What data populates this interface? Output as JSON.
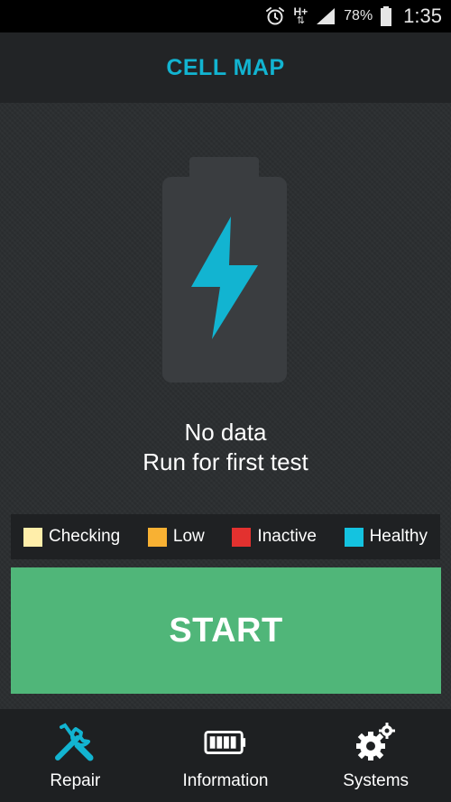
{
  "status_bar": {
    "network_label": "H+",
    "battery_percent": "78%",
    "time": "1:35",
    "icons": [
      "alarm-icon",
      "network-h-plus-icon",
      "signal-icon",
      "battery-icon"
    ]
  },
  "header": {
    "title": "CELL MAP",
    "title_color": "#12b4d1"
  },
  "battery_graphic": {
    "icon": "battery-charging-icon",
    "bolt_color": "#12b4d1"
  },
  "message": {
    "line1": "No data",
    "line2": "Run for first test"
  },
  "legend": {
    "items": [
      {
        "label": "Checking",
        "color": "#ffeeaa"
      },
      {
        "label": "Low",
        "color": "#f8b133"
      },
      {
        "label": "Inactive",
        "color": "#e3312f"
      },
      {
        "label": "Healthy",
        "color": "#14c3e0"
      }
    ]
  },
  "start_button": {
    "label": "START",
    "color": "#50b679"
  },
  "bottom_nav": {
    "items": [
      {
        "label": "Repair",
        "icon": "repair-tools-icon",
        "active": true,
        "icon_color": "#12b4d1"
      },
      {
        "label": "Information",
        "icon": "battery-info-icon",
        "active": false,
        "icon_color": "#ffffff"
      },
      {
        "label": "Systems",
        "icon": "gears-icon",
        "active": false,
        "icon_color": "#ffffff"
      }
    ]
  }
}
